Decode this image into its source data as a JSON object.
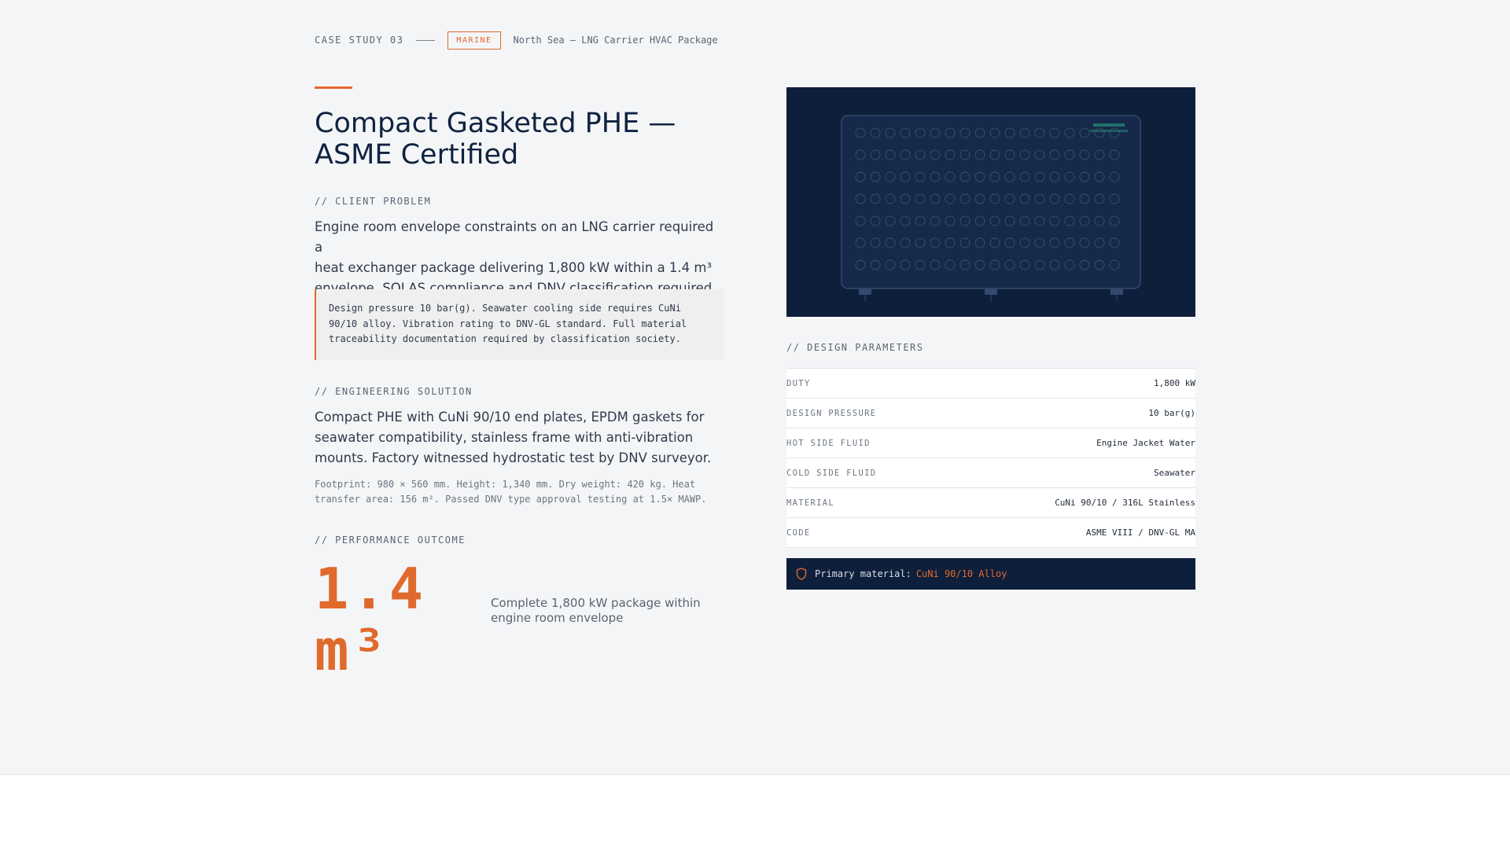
{
  "header": {
    "case_label": "CASE STUDY 03",
    "tag": "MARINE",
    "location": "North Sea — LNG Carrier HVAC Package"
  },
  "title": {
    "line1": "Compact Gasketed PHE —",
    "line2": "ASME Certified"
  },
  "client_problem": {
    "label": "// CLIENT PROBLEM",
    "lines": [
      "Engine room envelope constraints on an LNG carrier required a",
      "heat exchanger package delivering 1,800 kW within a 1.4 m³",
      "envelope. SOLAS compliance and DNV classification required."
    ],
    "note_lines": [
      "Design pressure 10 bar(g). Seawater cooling side requires CuNi",
      "90/10 alloy. Vibration rating to DNV-GL standard. Full material",
      "traceability documentation required by classification society."
    ]
  },
  "engineering_solution": {
    "label": "// ENGINEERING SOLUTION",
    "lines": [
      "Compact PHE with CuNi 90/10 end plates, EPDM gaskets for",
      "seawater compatibility, stainless frame with anti-vibration",
      "mounts. Factory witnessed hydrostatic test by DNV surveyor."
    ],
    "spec_lines": [
      "Footprint: 980 × 560 mm. Height: 1,340 mm. Dry weight: 420 kg. Heat",
      "transfer area: 156 m². Passed DNV type approval testing at 1.5× MAWP."
    ]
  },
  "performance_outcome": {
    "label": "// PERFORMANCE OUTCOME",
    "value_line1": "1.4",
    "value_line2": "m³",
    "desc_lines": [
      "Complete 1,800 kW package within",
      "engine room envelope"
    ]
  },
  "design_parameters": {
    "label": "// DESIGN PARAMETERS",
    "rows": [
      {
        "label": "DUTY",
        "value": "1,800 kW"
      },
      {
        "label": "DESIGN PRESSURE",
        "value": "10 bar(g)"
      },
      {
        "label": "HOT SIDE FLUID",
        "value": "Engine Jacket Water"
      },
      {
        "label": "COLD SIDE FLUID",
        "value": "Seawater"
      },
      {
        "label": "MATERIAL",
        "value": "CuNi 90/10 / 316L Stainless"
      },
      {
        "label": "CODE",
        "value": "ASME VIII / DNV-GL MA"
      }
    ]
  },
  "material_bar": {
    "label": "Primary material:",
    "value": "CuNi 90/10 Alloy",
    "icon": "shield-icon"
  },
  "colors": {
    "accent": "#e06a2b",
    "navy": "#0e1f3b",
    "page_bg": "#f4f5f7"
  }
}
